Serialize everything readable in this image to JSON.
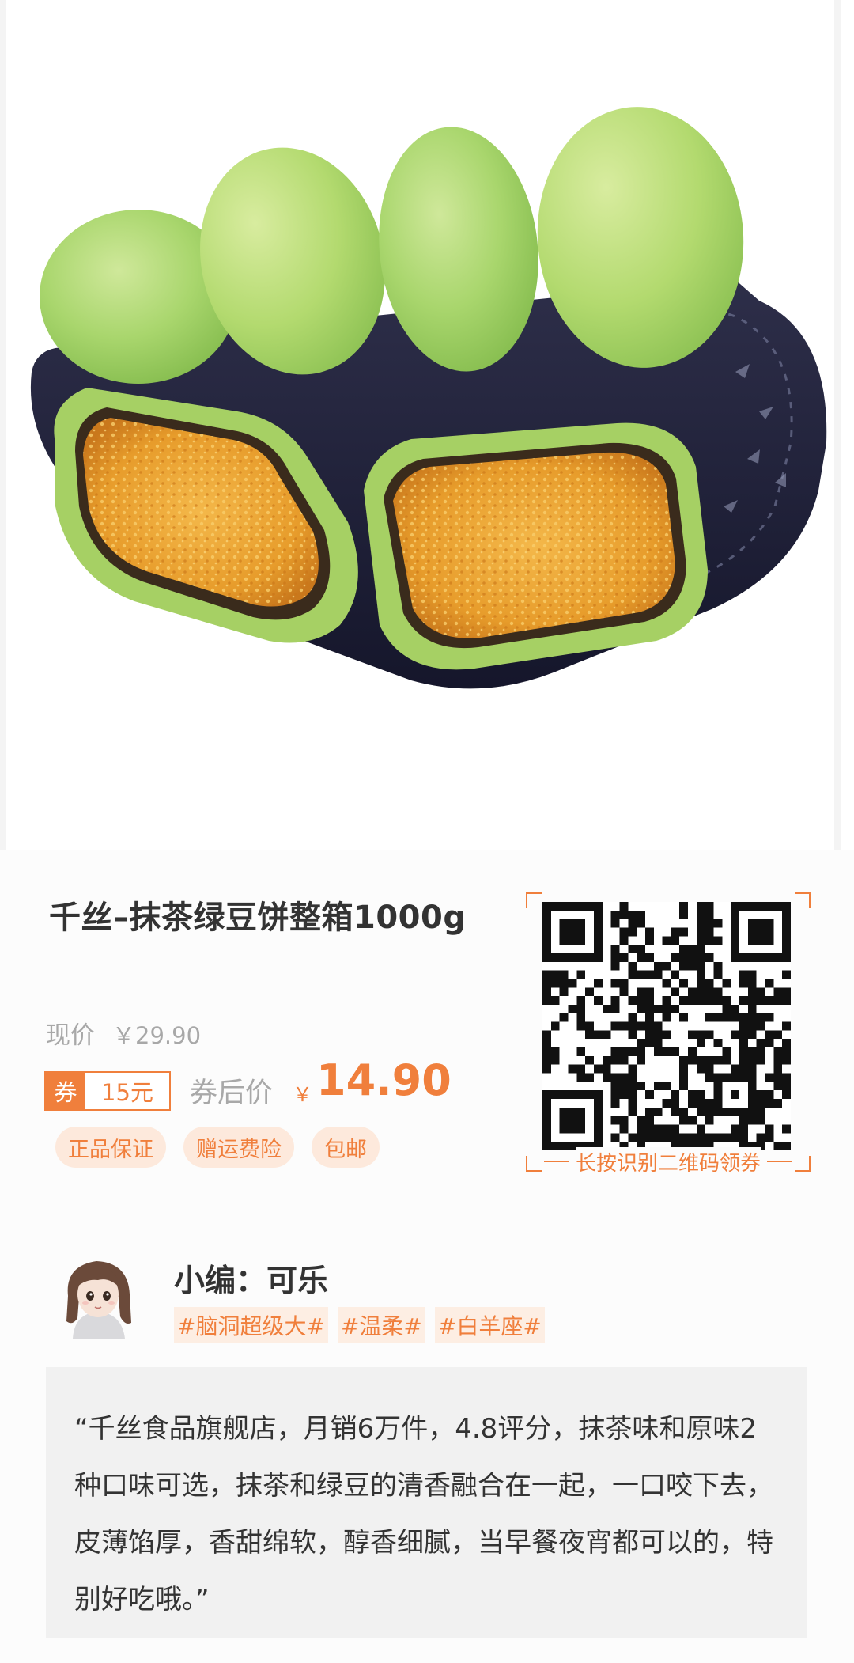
{
  "product": {
    "image_alt": "matcha mung bean cakes on a dark plate",
    "title": "千丝–抹茶绿豆饼整箱1000g",
    "original_price_label": "现价",
    "original_price": "￥29.90",
    "coupon_tag": "券",
    "coupon_amount": "15元",
    "after_coupon_label": "券后价",
    "currency": "￥",
    "after_coupon_price": "14.90",
    "badges": [
      "正品保证",
      "赠运费险",
      "包邮"
    ]
  },
  "qr": {
    "caption": "长按识别二维码领券"
  },
  "editor": {
    "name": "小编：可乐",
    "tags": [
      "#脑洞超级大#",
      "#温柔#",
      "#白羊座#"
    ]
  },
  "quote": {
    "text": "“千丝食品旗舰店，月销6万件，4.8评分，抹茶味和原味2种口味可选，抹茶和绿豆的清香融合在一起，一口咬下去，皮薄馅厚，香甜绵软，醇香细腻，当早餐夜宵都可以的，特别好吃哦。”"
  },
  "colors": {
    "accent": "#f07f3c",
    "badge_bg": "#fde9dc",
    "muted_text": "#a8a8a8",
    "quote_bg": "#f1f1f1"
  }
}
